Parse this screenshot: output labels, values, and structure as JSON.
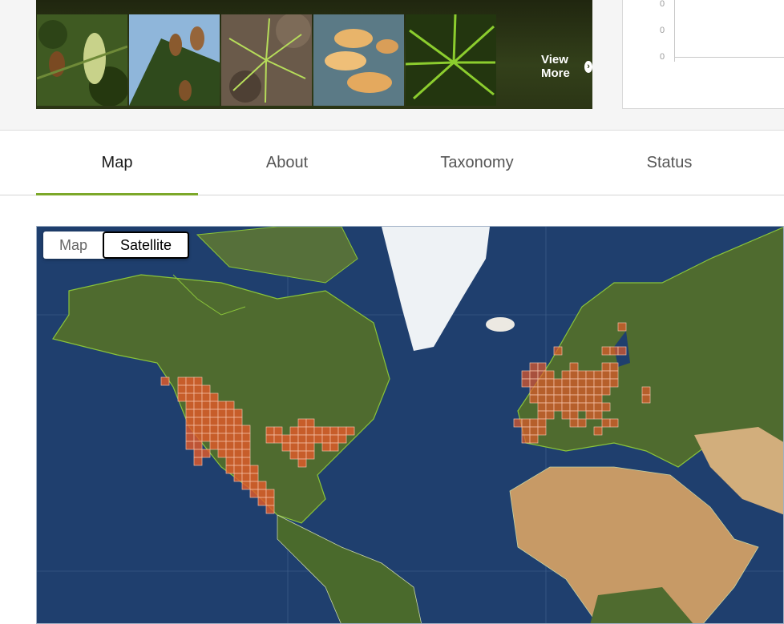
{
  "gallery": {
    "view_more_label": "View More",
    "thumbnails": [
      "cone-photo-1",
      "cone-photo-2",
      "needle-photo-3",
      "pollen-cone-photo-4",
      "needle-photo-5"
    ]
  },
  "chart_preview": {
    "tick_labels": [
      "0",
      "0",
      "0"
    ]
  },
  "tabs": [
    {
      "label": "Map",
      "active": true
    },
    {
      "label": "About",
      "active": false
    },
    {
      "label": "Taxonomy",
      "active": false
    },
    {
      "label": "Status",
      "active": false
    }
  ],
  "map": {
    "toggle": {
      "map_label": "Map",
      "satellite_label": "Satellite",
      "selected": "Satellite"
    },
    "colors": {
      "ocean": "#1f3f6e",
      "land": "#4f6b2f",
      "occurrence": "#e25a2a",
      "border": "#8ac43a"
    }
  }
}
